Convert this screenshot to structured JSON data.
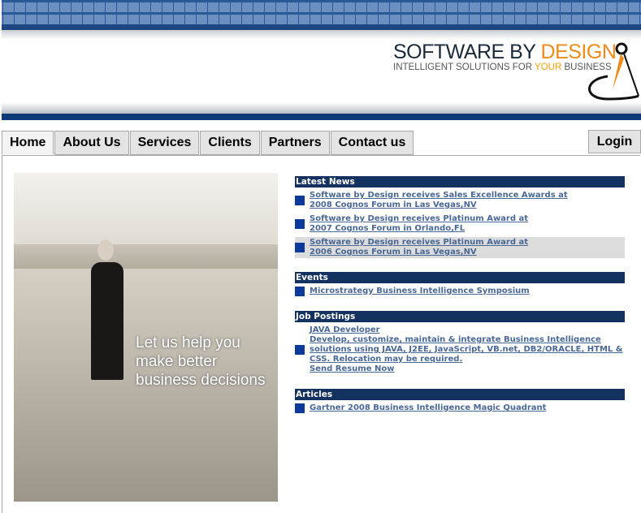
{
  "logo": {
    "name_a": "SOFTWARE BY ",
    "name_b": "DESIGN",
    "tag_a": "INTELLIGENT SOLUTIONS FOR ",
    "tag_b": "YOUR",
    "tag_c": " BUSINESS"
  },
  "nav": {
    "tabs": [
      "Home",
      "About Us",
      "Services",
      "Clients",
      "Partners",
      "Contact us"
    ],
    "login": "Login"
  },
  "photo": {
    "tagline": [
      "Let us help you",
      "make better",
      "business decisions"
    ]
  },
  "sections": {
    "news": {
      "title": "Latest News",
      "items": [
        [
          "Software by Design receives Sales Excellence Awards at",
          "2008 Cognos Forum in Las Vegas,NV"
        ],
        [
          "Software by Design receives Platinum Award at",
          "2007 Cognos Forum in Orlando,FL"
        ],
        [
          "Software by Design receives Platinum Award at",
          "2006 Cognos Forum in Las Vegas,NV"
        ]
      ]
    },
    "events": {
      "title": "Events",
      "items": [
        "Microstrategy Business Intelligence Symposium"
      ]
    },
    "jobs": {
      "title": "Job Postings",
      "job_title": "JAVA Developer",
      "description": "Develop, customize, maintain & integrate Business Intelligence solutions using JAVA, J2EE, JavaScript, VB.net, DB2/ORACLE, HTML & CSS. Relocation may be required.",
      "apply": "Send Resume Now"
    },
    "articles": {
      "title": "Articles",
      "items": [
        "Gartner 2008 Business Intelligence Magic Quadrant"
      ]
    }
  },
  "colors": {
    "header_bar": "#14325f",
    "bullet": "#0c3a9a",
    "link": "#4a6896",
    "accent": "#f08a1a"
  }
}
